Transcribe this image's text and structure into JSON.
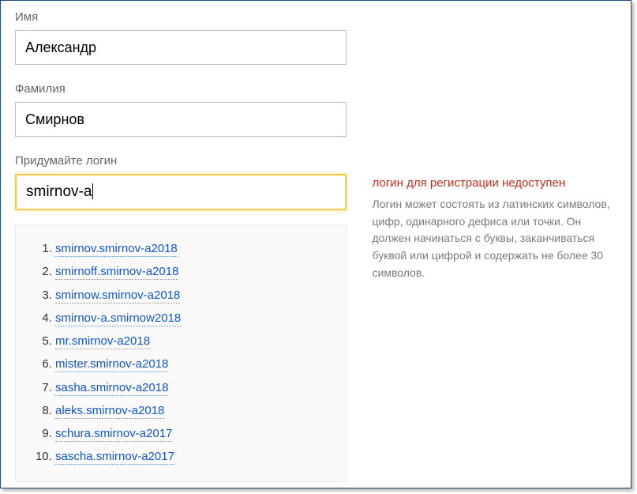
{
  "fields": {
    "first_name": {
      "label": "Имя",
      "value": "Александр"
    },
    "last_name": {
      "label": "Фамилия",
      "value": "Смирнов"
    },
    "login": {
      "label": "Придумайте логин",
      "value": "smirnov-a"
    }
  },
  "error": {
    "title": "логин для регистрации недоступен",
    "hint": "Логин может состоять из латинских символов, цифр, одинарного дефиса или точки. Он должен начинаться с буквы, заканчиваться буквой или цифрой и содержать не более 30 символов."
  },
  "suggestions": [
    "smirnov.smirnov-a2018",
    "smirnoff.smirnov-a2018",
    "smirnow.smirnov-a2018",
    "smirnov-a.smirnow2018",
    "mr.smirnov-a2018",
    "mister.smirnov-a2018",
    "sasha.smirnov-a2018",
    "aleks.smirnov-a2018",
    "schura.smirnov-a2017",
    "sascha.smirnov-a2017"
  ]
}
